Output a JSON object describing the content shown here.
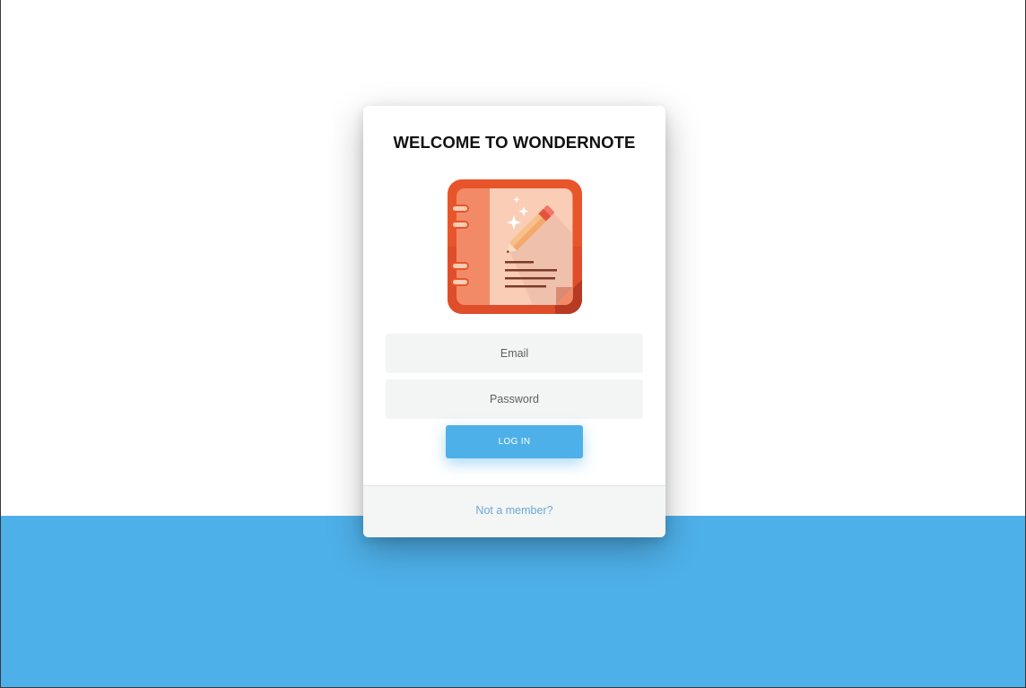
{
  "app": {
    "title": "WELCOME TO WONDERNOTE",
    "logo_icon": "notebook-pencil-icon"
  },
  "form": {
    "email_placeholder": "Email",
    "email_value": "",
    "password_placeholder": "Password",
    "password_value": "",
    "login_label": "LOG IN"
  },
  "footer": {
    "signup_label": "Not a member?"
  },
  "colors": {
    "accent": "#4eb0e9",
    "logo_orange": "#e8552a",
    "link": "#6aa8d8"
  }
}
